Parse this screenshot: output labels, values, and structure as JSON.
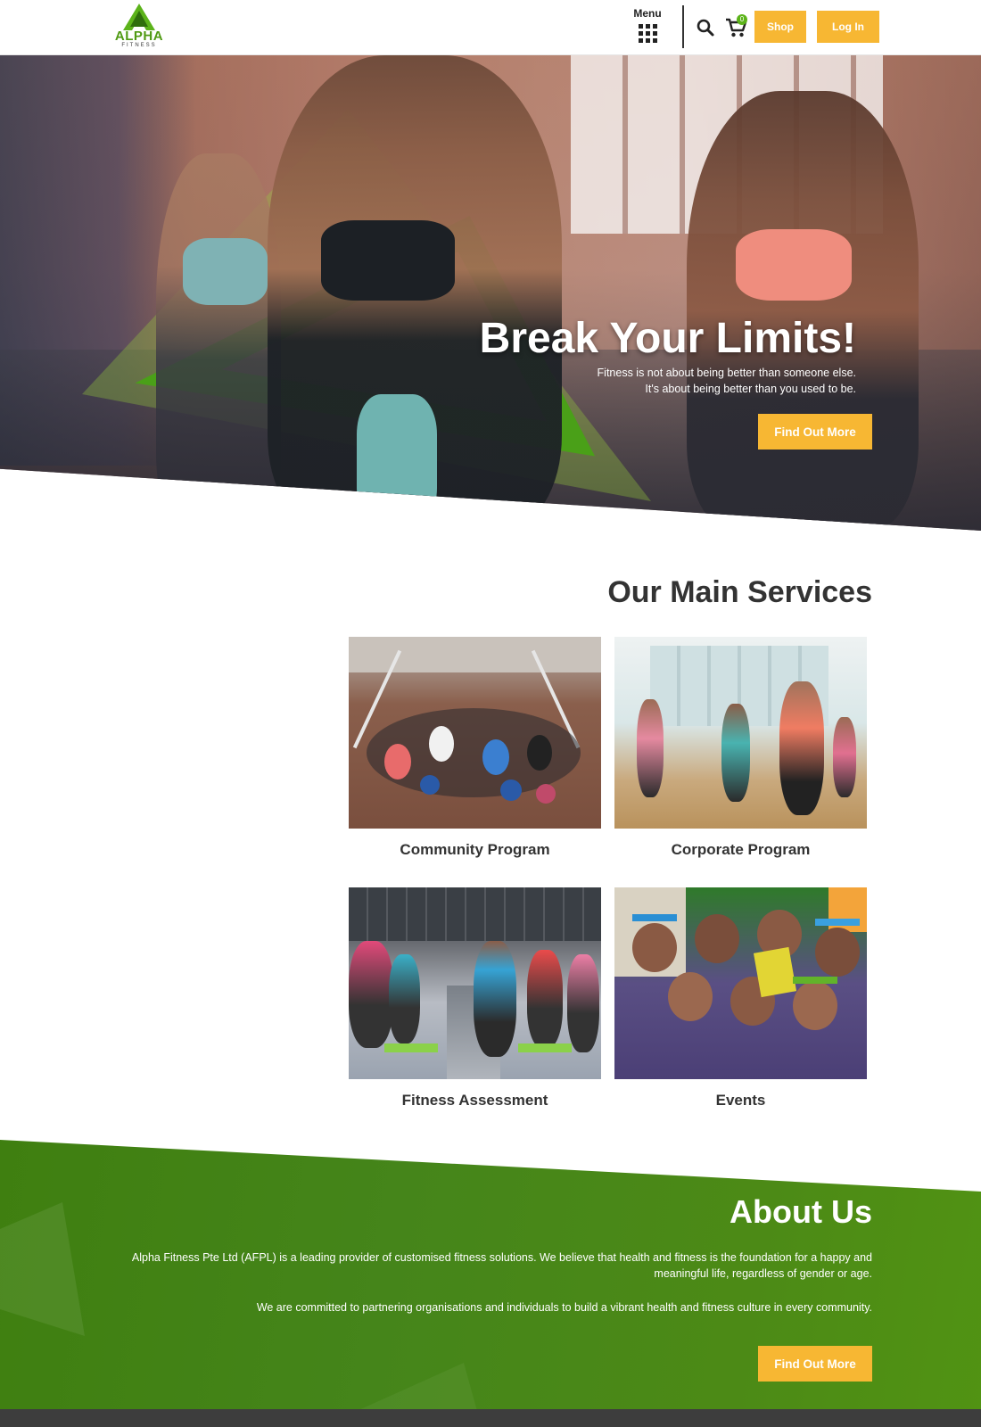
{
  "colors": {
    "brand_green": "#4f9a12",
    "accent_yellow": "#f7b733",
    "dark_text": "#333333",
    "about_bg": "#45851a"
  },
  "header": {
    "logo_text": "ALPHA",
    "logo_subtext": "FITNESS",
    "menu_label": "Menu",
    "cart_count": "0",
    "shop_label": "Shop",
    "login_label": "Log In",
    "icons": [
      "search-icon",
      "cart-icon",
      "menu-grid-icon"
    ]
  },
  "hero": {
    "title": "Break Your Limits!",
    "subtitle_line1": "Fitness is not about being better than someone else.",
    "subtitle_line2": "It's about being better than you used to be.",
    "cta_label": "Find Out More"
  },
  "services": {
    "title": "Our Main Services",
    "items": [
      {
        "label": "Community Program"
      },
      {
        "label": "Corporate Program"
      },
      {
        "label": "Fitness Assessment"
      },
      {
        "label": "Events"
      }
    ]
  },
  "about": {
    "title": "About Us",
    "paragraph1": "Alpha Fitness Pte Ltd (AFPL) is a leading provider of customised fitness solutions. We believe that health and fitness is the foundation for a happy and meaningful life, regardless of gender or age.",
    "paragraph2": "We are committed to partnering organisations and individuals to build a vibrant health and fitness culture in every community.",
    "cta_label": "Find Out More"
  }
}
